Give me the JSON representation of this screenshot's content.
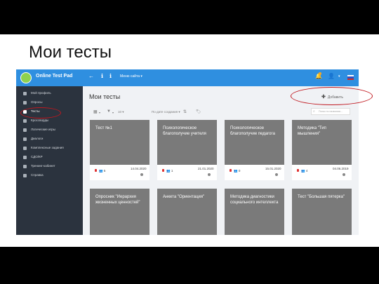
{
  "slide": {
    "title": "Мои тесты"
  },
  "app": {
    "brand": "Online Test Pad",
    "top_menu_label": "Меню сайта",
    "bell_badge": "2"
  },
  "sidebar": {
    "items": [
      {
        "label": "Мой профиль"
      },
      {
        "label": "Опросы"
      },
      {
        "label": "Тесты",
        "active": true
      },
      {
        "label": "Кроссворды"
      },
      {
        "label": "Логические игры"
      },
      {
        "label": "Диалоги"
      },
      {
        "label": "Комплексные задания"
      },
      {
        "label": "СДО/КР"
      },
      {
        "label": "Тренинг-кабинет"
      },
      {
        "label": "Справка"
      }
    ]
  },
  "main": {
    "title": "Мои тесты",
    "add_label": "Добавить",
    "filter_count": "10",
    "sort_label": "По дате создания",
    "search_placeholder": "Поиск по названию..."
  },
  "cards": [
    {
      "title": "Тест №1",
      "users": "5",
      "date": "14.04.2020"
    },
    {
      "title": "Психологическое благополучие учителя",
      "users": "1",
      "date": "21.01.2020"
    },
    {
      "title": "Психологическое благополучие педагога",
      "users": "0",
      "date": "15.01.2020"
    },
    {
      "title": "Методика \"Тип мышления\"",
      "users": "4",
      "date": "04.06.2019"
    }
  ],
  "cards_row2": [
    {
      "title": "Опросник \"Иерархия жизненных ценностей\""
    },
    {
      "title": "Анкета \"Ориентация\""
    },
    {
      "title": "Методика диагностики социального интеллекта"
    },
    {
      "title": "Тест \"Большая пятерка\""
    }
  ],
  "colors": {
    "topbar": "#2f8fe0",
    "sidebar": "#2b333e",
    "card": "#7a7a7a",
    "annotation": "#c0181f"
  }
}
